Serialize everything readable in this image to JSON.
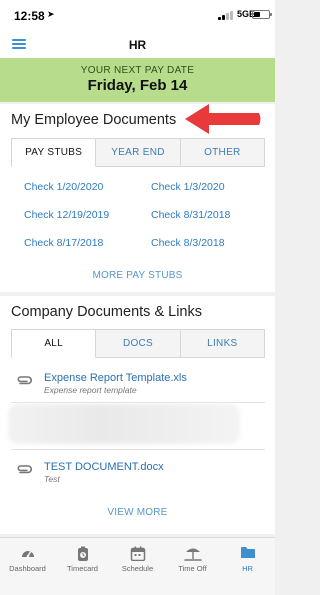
{
  "status_bar": {
    "time": "12:58",
    "network": "5GE"
  },
  "nav": {
    "title": "HR"
  },
  "pay_banner": {
    "label": "YOUR NEXT PAY DATE",
    "date": "Friday, Feb 14"
  },
  "employee_documents": {
    "title": "My Employee Documents",
    "tabs": [
      {
        "label": "PAY STUBS",
        "active": true
      },
      {
        "label": "YEAR END",
        "active": false
      },
      {
        "label": "OTHER",
        "active": false
      }
    ],
    "checks": [
      "Check 1/20/2020",
      "Check 1/3/2020",
      "Check 12/19/2019",
      "Check 8/31/2018",
      "Check 8/17/2018",
      "Check 8/3/2018"
    ],
    "more_label": "MORE PAY STUBS"
  },
  "company_documents": {
    "title": "Company Documents & Links",
    "tabs": [
      {
        "label": "ALL",
        "active": true
      },
      {
        "label": "DOCS",
        "active": false
      },
      {
        "label": "LINKS",
        "active": false
      }
    ],
    "items": [
      {
        "title": "Expense Report Template.xls",
        "subtitle": "Expense report template",
        "icon": "paperclip-icon"
      },
      {
        "title": "TEST DOCUMENT.docx",
        "subtitle": "Test",
        "icon": "paperclip-icon"
      }
    ],
    "view_more_label": "VIEW MORE"
  },
  "tab_bar": {
    "items": [
      {
        "label": "Dashboard",
        "icon": "speedometer-icon",
        "active": false
      },
      {
        "label": "Timecard",
        "icon": "stopwatch-icon",
        "active": false
      },
      {
        "label": "Schedule",
        "icon": "calendar-icon",
        "active": false
      },
      {
        "label": "Time Off",
        "icon": "beach-icon",
        "active": false
      },
      {
        "label": "HR",
        "icon": "folder-icon",
        "active": true
      }
    ]
  },
  "colors": {
    "accent": "#2f7bbf",
    "banner": "#b7dd8c",
    "arrow": "#e8393b"
  }
}
